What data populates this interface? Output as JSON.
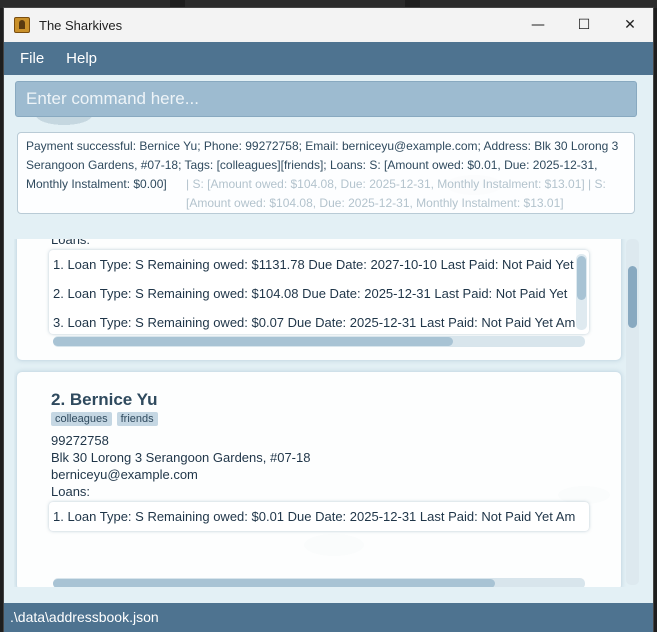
{
  "window": {
    "title": "The Sharkives",
    "minimize": "—",
    "maximize": "☐",
    "close": "✕"
  },
  "menu": {
    "file": "File",
    "help": "Help"
  },
  "command": {
    "placeholder": "Enter command here..."
  },
  "result": {
    "text": "Payment successful: Bernice Yu; Phone: 99272758; Email: berniceyu@example.com; Address: Blk 30 Lorong 3 Serangoon Gardens, #07-18; Tags: [colleagues][friends]; Loans: S: [Amount owed: $0.01, Due: 2025-12-31, Monthly Instalment: $0.00]",
    "ghost": "| S: [Amount owed: $104.08, Due: 2025-12-31, Monthly Instalment: $13.01] | S: [Amount owed: $104.08, Due: 2025-12-31, Monthly Instalment: $13.01]"
  },
  "persons": [
    {
      "loans_label": "Loans:",
      "loans": [
        "1. Loan Type: S   Remaining owed: $1131.78   Due Date: 2027-10-10   Last Paid: Not Paid Yet",
        "2. Loan Type: S   Remaining owed: $104.08   Due Date: 2025-12-31   Last Paid: Not Paid Yet",
        "3. Loan Type: S   Remaining owed: $0.07   Due Date: 2025-12-31   Last Paid: Not Paid Yet   Am"
      ]
    },
    {
      "index_name": "2.  Bernice Yu",
      "tags": [
        "colleagues",
        "friends"
      ],
      "phone": "99272758",
      "address": "Blk 30 Lorong 3 Serangoon Gardens, #07-18",
      "email": "berniceyu@example.com",
      "loans_label": "Loans:",
      "loans": [
        "1. Loan Type: S   Remaining owed: $0.01   Due Date: 2025-12-31   Last Paid: Not Paid Yet   Am"
      ]
    }
  ],
  "status": {
    "path": ".\\data\\addressbook.json"
  }
}
